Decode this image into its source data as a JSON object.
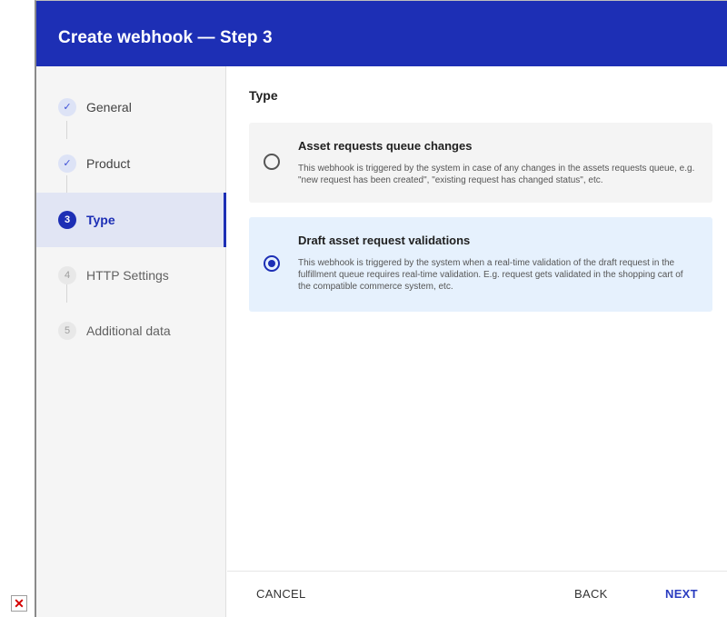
{
  "dialog": {
    "title": "Create webhook — Step 3"
  },
  "steps": [
    {
      "badge": "✓",
      "label": "General",
      "state": "done"
    },
    {
      "badge": "✓",
      "label": "Product",
      "state": "done"
    },
    {
      "badge": "3",
      "label": "Type",
      "state": "active"
    },
    {
      "badge": "4",
      "label": "HTTP Settings",
      "state": "pending"
    },
    {
      "badge": "5",
      "label": "Additional data",
      "state": "pending"
    }
  ],
  "content": {
    "section_title": "Type",
    "options": [
      {
        "title": "Asset requests queue changes",
        "description": "This webhook is triggered by the system in case of any changes in the assets requests queue, e.g. \"new request has been created\", \"existing request has changed status\", etc.",
        "selected": false
      },
      {
        "title": "Draft asset request validations",
        "description": "This webhook is triggered by the system when a real-time validation of the draft request in the fulfillment queue requires real-time validation. E.g. request gets validated in the shopping cart of the compatible commerce system, etc.",
        "selected": true
      }
    ]
  },
  "footer": {
    "cancel": "CANCEL",
    "back": "BACK",
    "next": "NEXT"
  },
  "colors": {
    "brand": "#1d2fb5",
    "selected_bg": "#e6f1fd",
    "sidebar_bg": "#f5f5f5"
  },
  "icons": {
    "broken_image": "broken-image-icon",
    "check": "check-icon",
    "radio": "radio-icon"
  }
}
